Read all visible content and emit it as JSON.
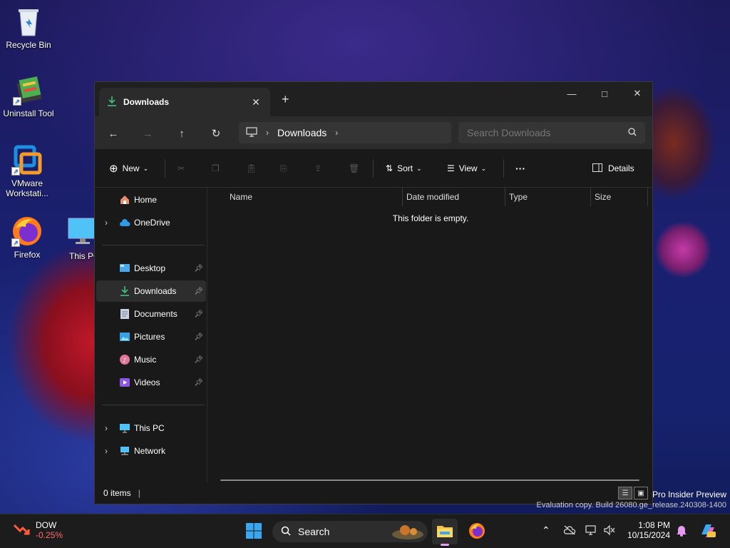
{
  "desktop": {
    "icons": [
      {
        "label": "Recycle Bin"
      },
      {
        "label": "Uninstall Tool"
      },
      {
        "label": "VMware Workstati..."
      },
      {
        "label": "Firefox"
      },
      {
        "label": "This PC"
      }
    ]
  },
  "window": {
    "tab_title": "Downloads",
    "controls": {
      "minimize": "—",
      "maximize": "□",
      "close": "✕"
    },
    "address": {
      "crumb": "Downloads"
    },
    "search": {
      "placeholder": "Search Downloads"
    },
    "commands": {
      "new_label": "New",
      "sort_label": "Sort",
      "view_label": "View",
      "more_label": "···",
      "details_label": "Details"
    },
    "sidebar": {
      "home": "Home",
      "onedrive": "OneDrive",
      "quick_access": [
        {
          "label": "Desktop",
          "pinned": true
        },
        {
          "label": "Downloads",
          "pinned": true,
          "selected": true
        },
        {
          "label": "Documents",
          "pinned": true
        },
        {
          "label": "Pictures",
          "pinned": true
        },
        {
          "label": "Music",
          "pinned": true
        },
        {
          "label": "Videos",
          "pinned": true
        }
      ],
      "this_pc": "This PC",
      "network": "Network"
    },
    "columns": [
      "Name",
      "Date modified",
      "Type",
      "Size"
    ],
    "empty_message": "This folder is empty.",
    "status": {
      "item_count": "0 items"
    }
  },
  "watermark": {
    "line1": "Pro Insider Preview",
    "line2": "Evaluation copy. Build 26080.ge_release.240308-1400"
  },
  "taskbar": {
    "widget": {
      "name": "DOW",
      "change": "-0.25%"
    },
    "search_label": "Search",
    "clock": {
      "time": "1:08 PM",
      "date": "10/15/2024"
    }
  },
  "colors": {
    "accent_download": "#3fc37a",
    "window_bg": "#191919",
    "taskbar_bg": "#1c1c1c",
    "dow_negative": "#ff6a6a"
  }
}
